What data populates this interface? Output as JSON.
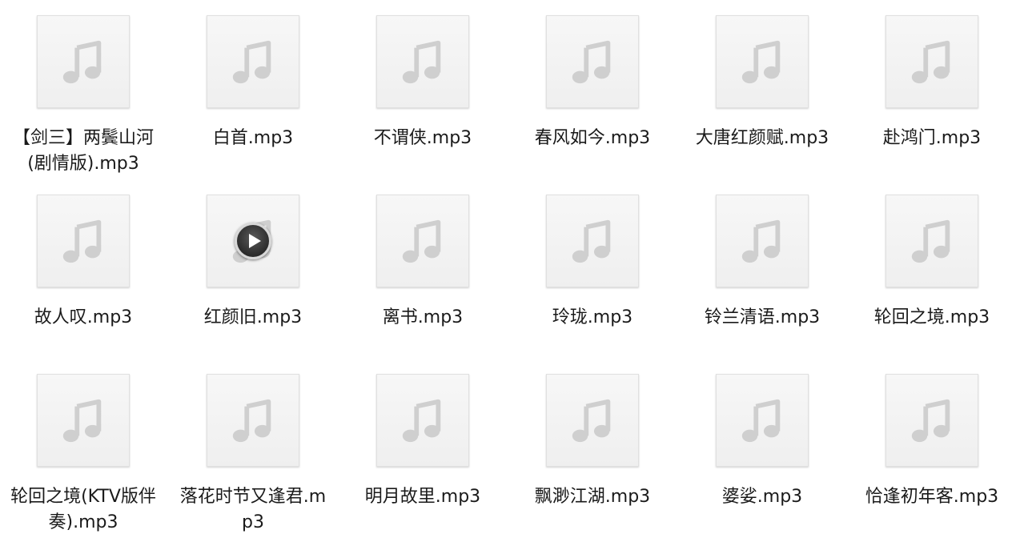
{
  "files": [
    {
      "name": "【剑三】两鬓山河(剧情版).mp3",
      "icon": "music-note-icon"
    },
    {
      "name": "白首.mp3",
      "icon": "music-note-icon"
    },
    {
      "name": "不谓侠.mp3",
      "icon": "music-note-icon"
    },
    {
      "name": "春风如今.mp3",
      "icon": "music-note-icon"
    },
    {
      "name": "大唐红颜赋.mp3",
      "icon": "music-note-icon"
    },
    {
      "name": "赴鸿门.mp3",
      "icon": "music-note-icon"
    },
    {
      "name": "故人叹.mp3",
      "icon": "music-note-icon"
    },
    {
      "name": "红颜旧.mp3",
      "icon": "play-icon"
    },
    {
      "name": "离书.mp3",
      "icon": "music-note-icon"
    },
    {
      "name": "玲珑.mp3",
      "icon": "music-note-icon"
    },
    {
      "name": "铃兰清语.mp3",
      "icon": "music-note-icon"
    },
    {
      "name": "轮回之境.mp3",
      "icon": "music-note-icon"
    },
    {
      "name": "轮回之境(KTV版伴奏).mp3",
      "icon": "music-note-icon"
    },
    {
      "name": "落花时节又逢君.mp3",
      "icon": "music-note-icon"
    },
    {
      "name": "明月故里.mp3",
      "icon": "music-note-icon"
    },
    {
      "name": "飘渺江湖.mp3",
      "icon": "music-note-icon"
    },
    {
      "name": "婆娑.mp3",
      "icon": "music-note-icon"
    },
    {
      "name": "恰逢初年客.mp3",
      "icon": "music-note-icon"
    }
  ],
  "colors": {
    "thumb_background": "#f2f2f2",
    "note_color": "#d2d2d2",
    "text_color": "#1a1a1a",
    "play_button_background": "#2b2b2b"
  }
}
